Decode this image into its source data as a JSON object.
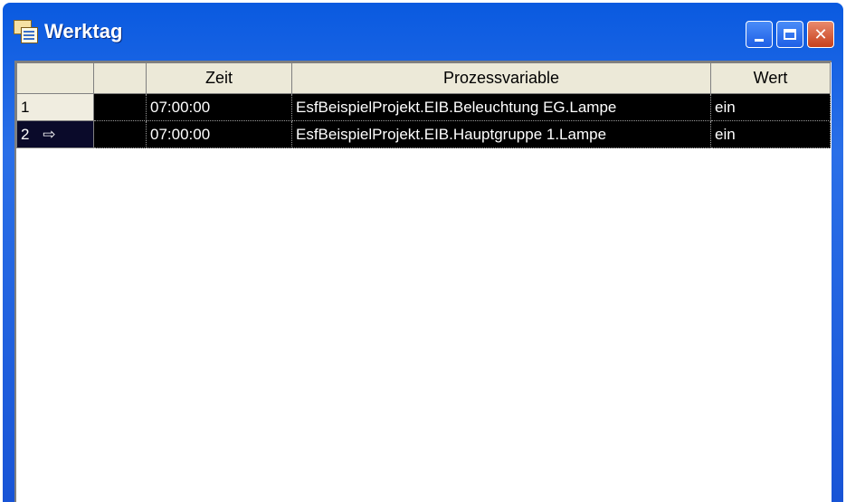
{
  "window": {
    "title": "Werktag"
  },
  "controls": {
    "minimize": "minimize-icon",
    "maximize": "maximize-icon",
    "close": "✕"
  },
  "table": {
    "columns": [
      "",
      "",
      "Zeit",
      "Prozessvariable",
      "Wert"
    ],
    "rows": [
      {
        "num": "1",
        "arrow": "",
        "zeit": "07:00:00",
        "variable": "EsfBeispielProjekt.EIB.Beleuchtung EG.Lampe",
        "wert": "ein"
      },
      {
        "num": "2",
        "arrow": "⇨",
        "zeit": "07:00:00",
        "variable": "EsfBeispielProjekt.EIB.Hauptgruppe 1.Lampe",
        "wert": "ein"
      }
    ]
  },
  "colors": {
    "titlebar": "#1854d6",
    "selected_row": "#000000",
    "header_bg": "#ece9d8"
  }
}
